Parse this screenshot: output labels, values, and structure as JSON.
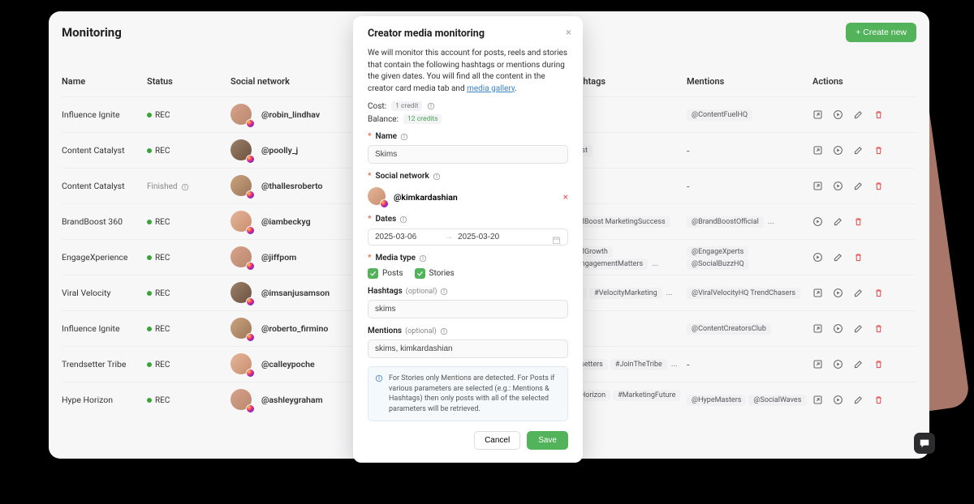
{
  "page": {
    "title": "Monitoring",
    "create_button": "+ Create new"
  },
  "columns": {
    "name": "Name",
    "status": "Status",
    "social": "Social network",
    "hashtags": "Hashtags",
    "mentions": "Mentions",
    "actions": "Actions"
  },
  "status_labels": {
    "rec": "REC",
    "finished": "Finished"
  },
  "rows": [
    {
      "name": "Influence Ignite",
      "status": "rec",
      "handle": "@robin_lindhav",
      "hashtags_overflow": "",
      "mentions": [
        "@ContentFuelHQ"
      ],
      "mentions_overflow": "",
      "action_set": "all"
    },
    {
      "name": "Content Catalyst",
      "status": "rec",
      "handle": "@poolly_j",
      "hashtags_overflow": "alyst",
      "mentions": [],
      "mentions_overflow": "",
      "action_set": "all"
    },
    {
      "name": "Content Catalyst",
      "status": "finished",
      "handle": "@thallesroberto",
      "hashtags_overflow": "",
      "mentions": [],
      "mentions_overflow": "",
      "action_set": "all"
    },
    {
      "name": "BrandBoost 360",
      "status": "rec",
      "handle": "@iambeckyg",
      "hashtags_overflow": "andBoost MarketingSuccess",
      "mentions": [
        "@BrandBoostOfficial"
      ],
      "mentions_overflow": "...",
      "action_set": "no-open"
    },
    {
      "name": "EngageXperience",
      "status": "rec",
      "handle": "@jiffpom",
      "hashtags_overflow": "andGrowth",
      "hashtags_tags": [
        "#EngagementMatters"
      ],
      "hashtags_ellipsis": "...",
      "mentions": [
        "@EngageXperts",
        "@SocialBuzzHQ"
      ],
      "mentions_overflow": "",
      "action_set": "no-open"
    },
    {
      "name": "Viral Velocity",
      "status": "rec",
      "handle": "@imsanjusamson",
      "hashtags_overflow": "iral",
      "hashtags_tags": [
        "#VelocityMarketing"
      ],
      "hashtags_ellipsis": "...",
      "mentions": [
        "@ViralVelocityHQ TrendChasers"
      ],
      "mentions_overflow": "",
      "action_set": "all"
    },
    {
      "name": "Influence Ignite",
      "status": "rec",
      "handle": "@roberto_firmino",
      "hashtags_overflow": "",
      "mentions": [
        "@ContentCreatorsClub"
      ],
      "mentions_overflow": "",
      "action_set": "all"
    },
    {
      "name": "Trendsetter Tribe",
      "status": "rec",
      "handle": "@calleypoche",
      "hashtags_overflow": "ndsetters",
      "hashtags_tags": [
        "#JoinTheTribe"
      ],
      "hashtags_ellipsis": "...",
      "mentions": [],
      "mentions_overflow": "",
      "action_set": "all"
    },
    {
      "name": "Hype Horizon",
      "status": "rec",
      "handle": "@ashleygraham",
      "hashtags_overflow": "peHorizon",
      "hashtags_tags": [
        "#MarketingFuture"
      ],
      "hashtags_ellipsis": "...",
      "mentions": [
        "@HypeMasters",
        "@SocialWaves"
      ],
      "mentions_overflow": "",
      "action_set": "all"
    }
  ],
  "modal": {
    "title": "Creator media monitoring",
    "description": "We will monitor this account for posts, reels and stories that contain the following hashtags or mentions during the given dates.  You will find all the content in the creator card media tab and ",
    "description_link": "media gallery",
    "cost_label": "Cost:",
    "cost_value": "1 credit",
    "balance_label": "Balance:",
    "balance_value": "12 credits",
    "name_label": "Name",
    "name_value": "Skims",
    "social_label": "Social network",
    "social_handle": "@kimkardashian",
    "dates_label": "Dates",
    "date_start": "2025-03-06",
    "date_end": "2025-03-20",
    "media_label": "Media type",
    "media_posts": "Posts",
    "media_stories": "Stories",
    "hashtags_label": "Hashtags",
    "hashtags_optional": "(optional)",
    "hashtags_value": "skims",
    "mentions_label": "Mentions",
    "mentions_optional": "(optional)",
    "mentions_value": "skims, kimkardashian",
    "hint": "For Stories only Mentions are detected. For Posts if various parameters are selected (e.g.: Mentions & Hashtags) then only posts with all of the selected parameters will be retrieved.",
    "cancel": "Cancel",
    "save": "Save"
  }
}
